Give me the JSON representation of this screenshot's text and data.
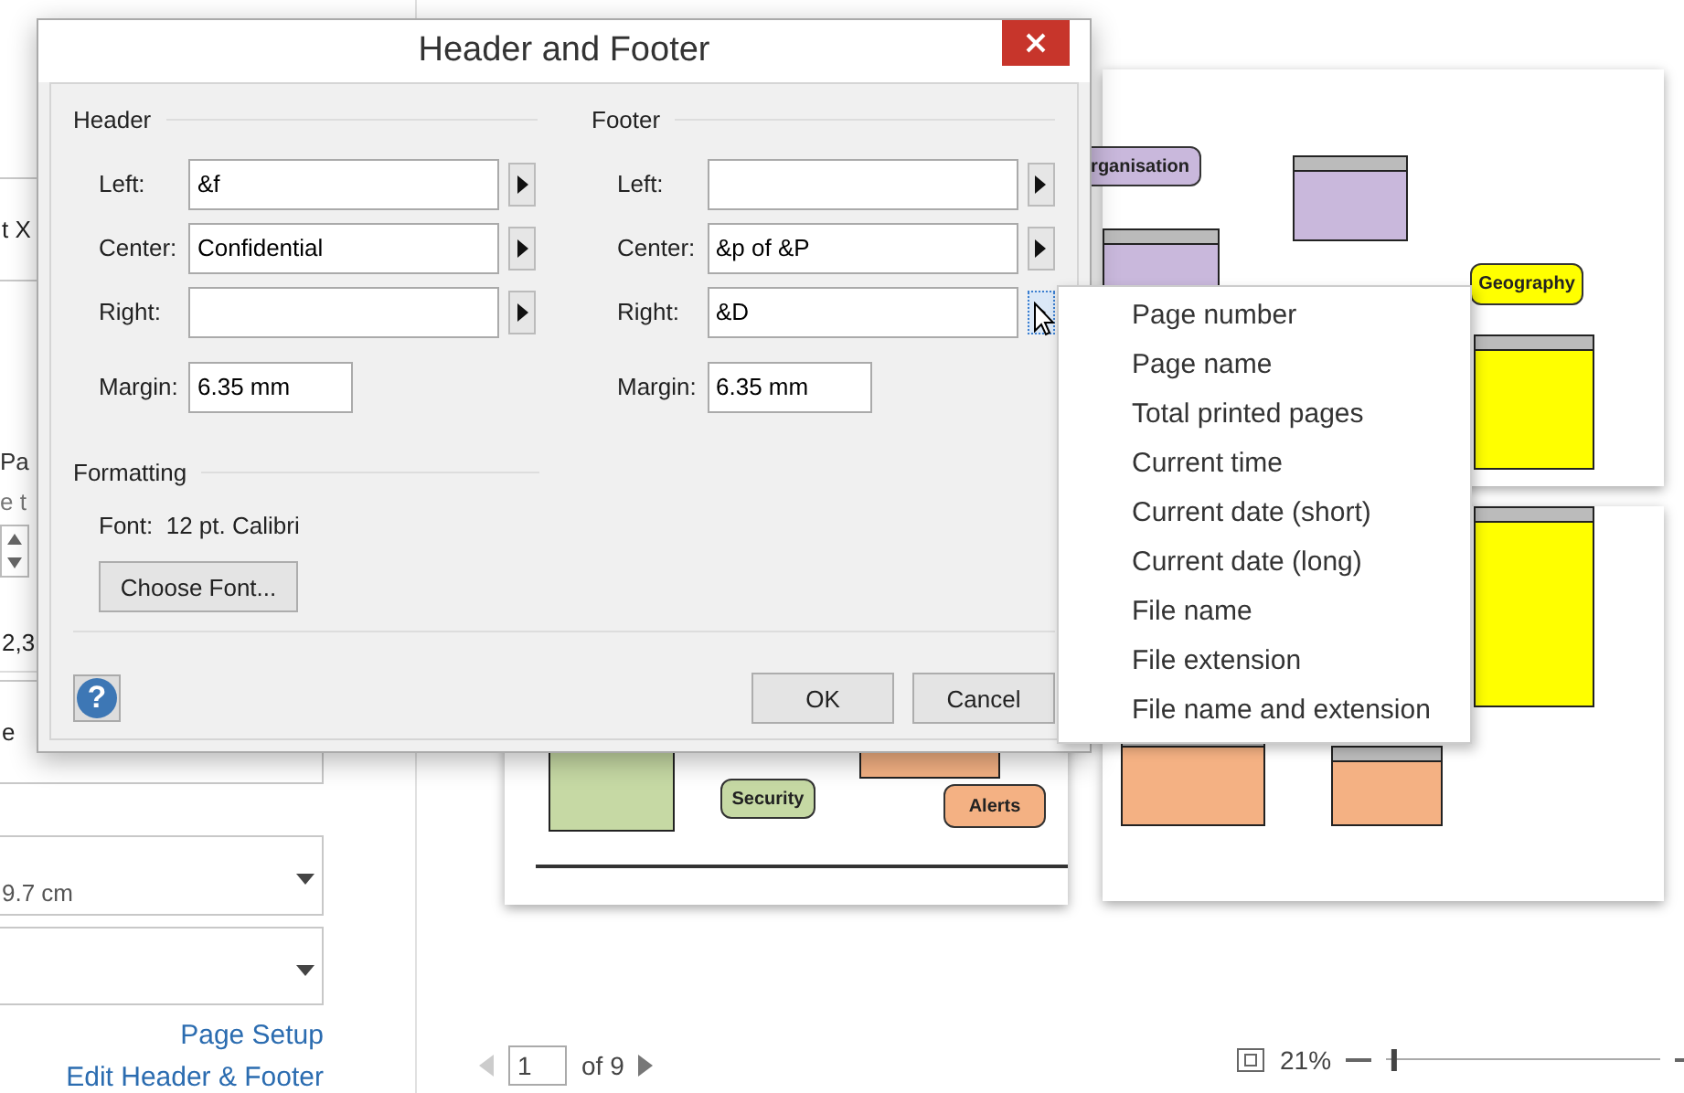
{
  "side_panel": {
    "fragments": [
      {
        "text": "t X",
        "kind": "field"
      },
      {
        "text": "Pa",
        "kind": "label"
      },
      {
        "text": "e t",
        "kind": "hint"
      },
      {
        "kind": "spinner"
      },
      {
        "text": "2,3",
        "kind": "ruled_hint"
      },
      {
        "text": "e",
        "kind": "field"
      },
      {
        "text": "9.7 cm",
        "kind": "dropdown"
      },
      {
        "kind": "dropdown"
      }
    ],
    "links": [
      "Page Setup",
      "Edit Header & Footer"
    ]
  },
  "preview": {
    "pages": [
      {
        "shapes": [
          {
            "label": "Security",
            "color": "#c6d9a4"
          },
          {
            "label": "Alerts",
            "color": "#f4b183"
          }
        ]
      },
      {
        "shapes": [
          {
            "label": "rganisation",
            "color": "#c9b8dc"
          },
          {
            "label": "Geography",
            "color": "#ffff00"
          }
        ]
      }
    ],
    "page_input": "1",
    "page_total": "of 9",
    "zoom": "21%",
    "zoom_slider": {
      "level": 0.02
    }
  },
  "dialog": {
    "title": "Header and Footer",
    "header": {
      "title": "Header",
      "fields": [
        {
          "label": "Left:",
          "value": "&f",
          "active": false
        },
        {
          "label": "Center:",
          "value": "Confidential",
          "active": false
        },
        {
          "label": "Right:",
          "active": false
        }
      ],
      "margin_label": "Margin:",
      "margin": "6.35 mm"
    },
    "footer": {
      "title": "Footer",
      "fields": [
        {
          "label": "Left:",
          "active": false
        },
        {
          "label": "Center:",
          "value": "&p of &P",
          "active": false
        },
        {
          "label": "Right:",
          "value": "&D",
          "active": true
        }
      ],
      "margin_label": "Margin:",
      "margin": "6.35 mm"
    },
    "formatting": {
      "title": "Formatting",
      "font_label": "Font:",
      "font": "12 pt. Calibri",
      "button": "Choose Font..."
    },
    "help": "?",
    "buttons": [
      "OK",
      "Cancel"
    ]
  },
  "menu": {
    "items": [
      "Page number",
      "Page name",
      "Total printed pages",
      "Current time",
      "Current date (short)",
      "Current date (long)",
      "File name",
      "File extension",
      "File name and extension"
    ]
  }
}
